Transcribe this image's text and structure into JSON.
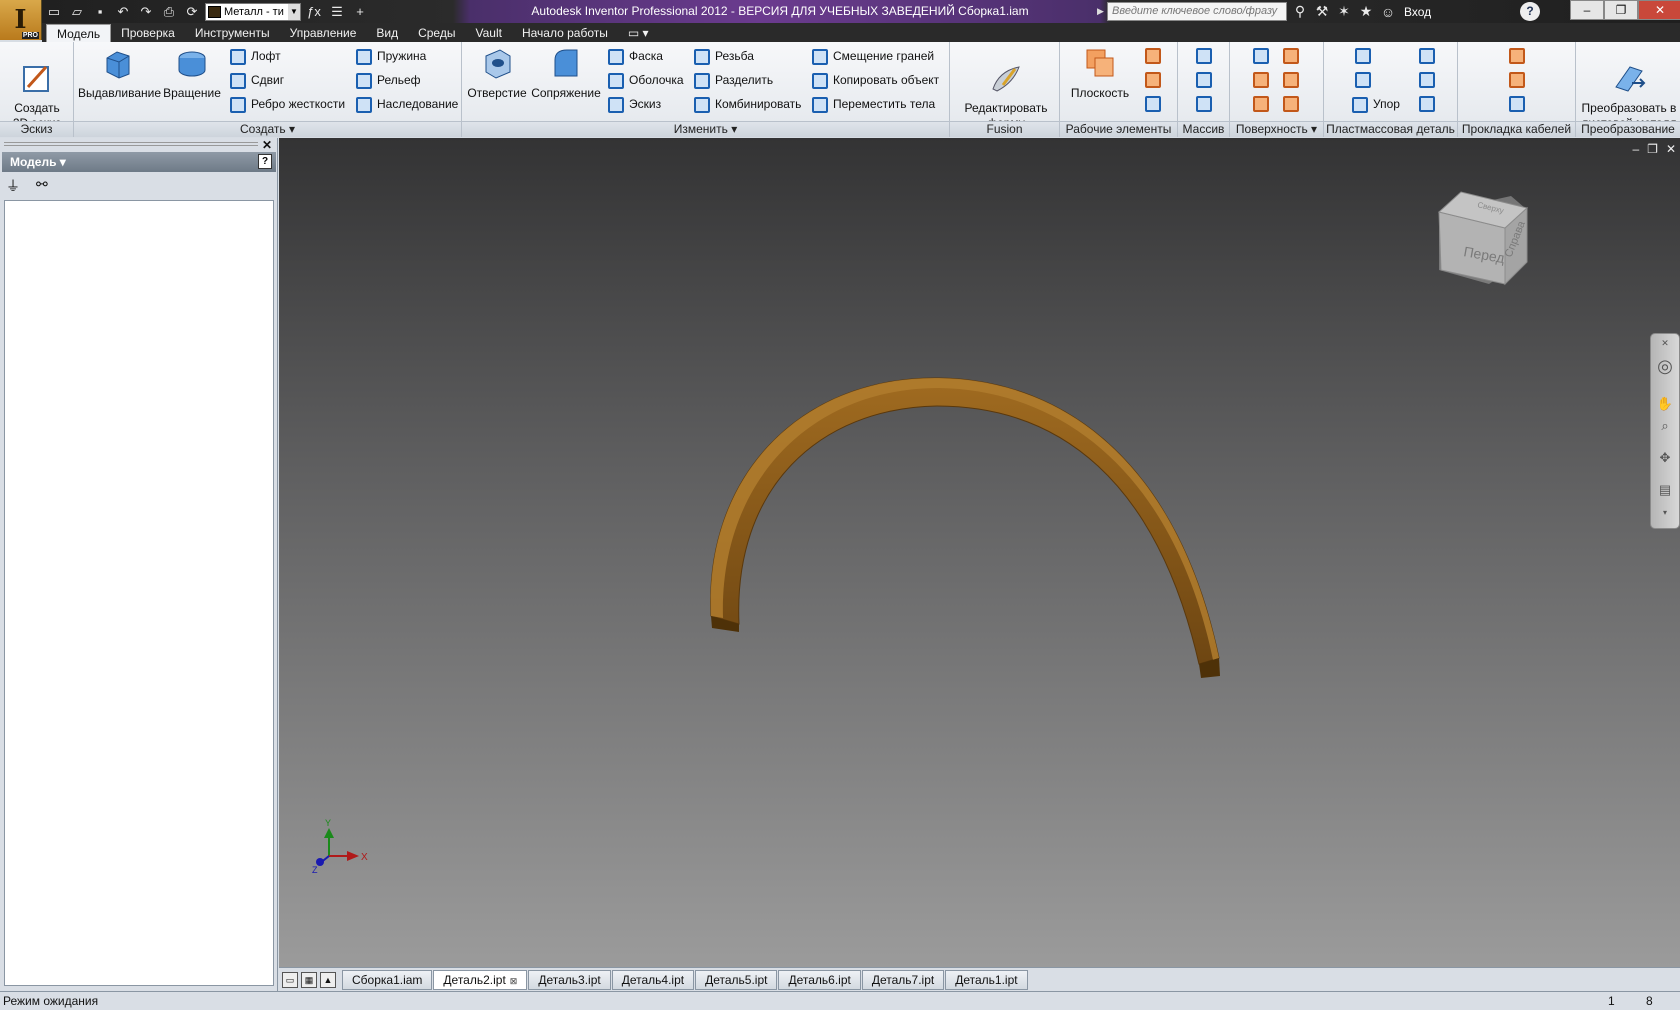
{
  "title_bar": {
    "window_title": "Autodesk Inventor Professional 2012 - ВЕРСИЯ ДЛЯ УЧЕБНЫХ ЗАВЕДЕНИЙ    Сборка1.iam",
    "material": "Металл - ти",
    "search_placeholder": "Введите ключевое слово/фразу",
    "login": "Вход",
    "app_logo": "I",
    "app_badge": "PRO",
    "help": "?"
  },
  "ribbon_tabs": [
    "Модель",
    "Проверка",
    "Инструменты",
    "Управление",
    "Вид",
    "Среды",
    "Vault",
    "Начало работы"
  ],
  "active_tab": "Модель",
  "ribbon": {
    "sketch": {
      "label": "Эскиз",
      "create_2d_sketch": "Создать\n2D эскиз"
    },
    "create": {
      "label": "Создать",
      "extrude": "Выдавливание",
      "revolve": "Вращение",
      "loft": "Лофт",
      "sweep": "Сдвиг",
      "rib": "Ребро жесткости",
      "coil": "Пружина",
      "emboss": "Рельеф",
      "derive": "Наследование"
    },
    "modify": {
      "label": "Изменить",
      "hole": "Отверстие",
      "fillet": "Сопряжение",
      "chamfer": "Фаска",
      "shell": "Оболочка",
      "draft": "Эскиз",
      "thread": "Резьба",
      "split": "Разделить",
      "combine": "Комбинировать",
      "offset_faces": "Смещение граней",
      "copy_object": "Копировать объект",
      "move_bodies": "Переместить тела"
    },
    "fusion": {
      "label": "Fusion",
      "edit_form": "Редактировать\nформу"
    },
    "work_features": {
      "label": "Рабочие элементы",
      "plane": "Плоскость"
    },
    "pattern": {
      "label": "Массив"
    },
    "surface": {
      "label": "Поверхность"
    },
    "plastic_part": {
      "label": "Пластмассовая деталь",
      "rest": "Упор"
    },
    "cable": {
      "label": "Прокладка кабелей"
    },
    "convert": {
      "label": "Преобразование",
      "convert_sheet_metal": "Преобразовать в\nлистовой металл"
    }
  },
  "browser": {
    "title": "Модель",
    "help": "?"
  },
  "viewcube": {
    "front": "Перед",
    "right": "Справа",
    "top": "Сверху"
  },
  "axis": {
    "x": "X",
    "y": "Y",
    "z": "Z"
  },
  "document_tabs": [
    "Сборка1.iam",
    "Деталь2.ipt",
    "Деталь3.ipt",
    "Деталь4.ipt",
    "Деталь5.ipt",
    "Деталь6.ipt",
    "Деталь7.ipt",
    "Деталь1.ipt"
  ],
  "active_document": "Деталь2.ipt",
  "status": {
    "text": "Режим ожидания",
    "n1": "1",
    "n2": "8"
  },
  "colors": {
    "part": "#8a5a18",
    "title_accent": "#6b3b8f"
  }
}
